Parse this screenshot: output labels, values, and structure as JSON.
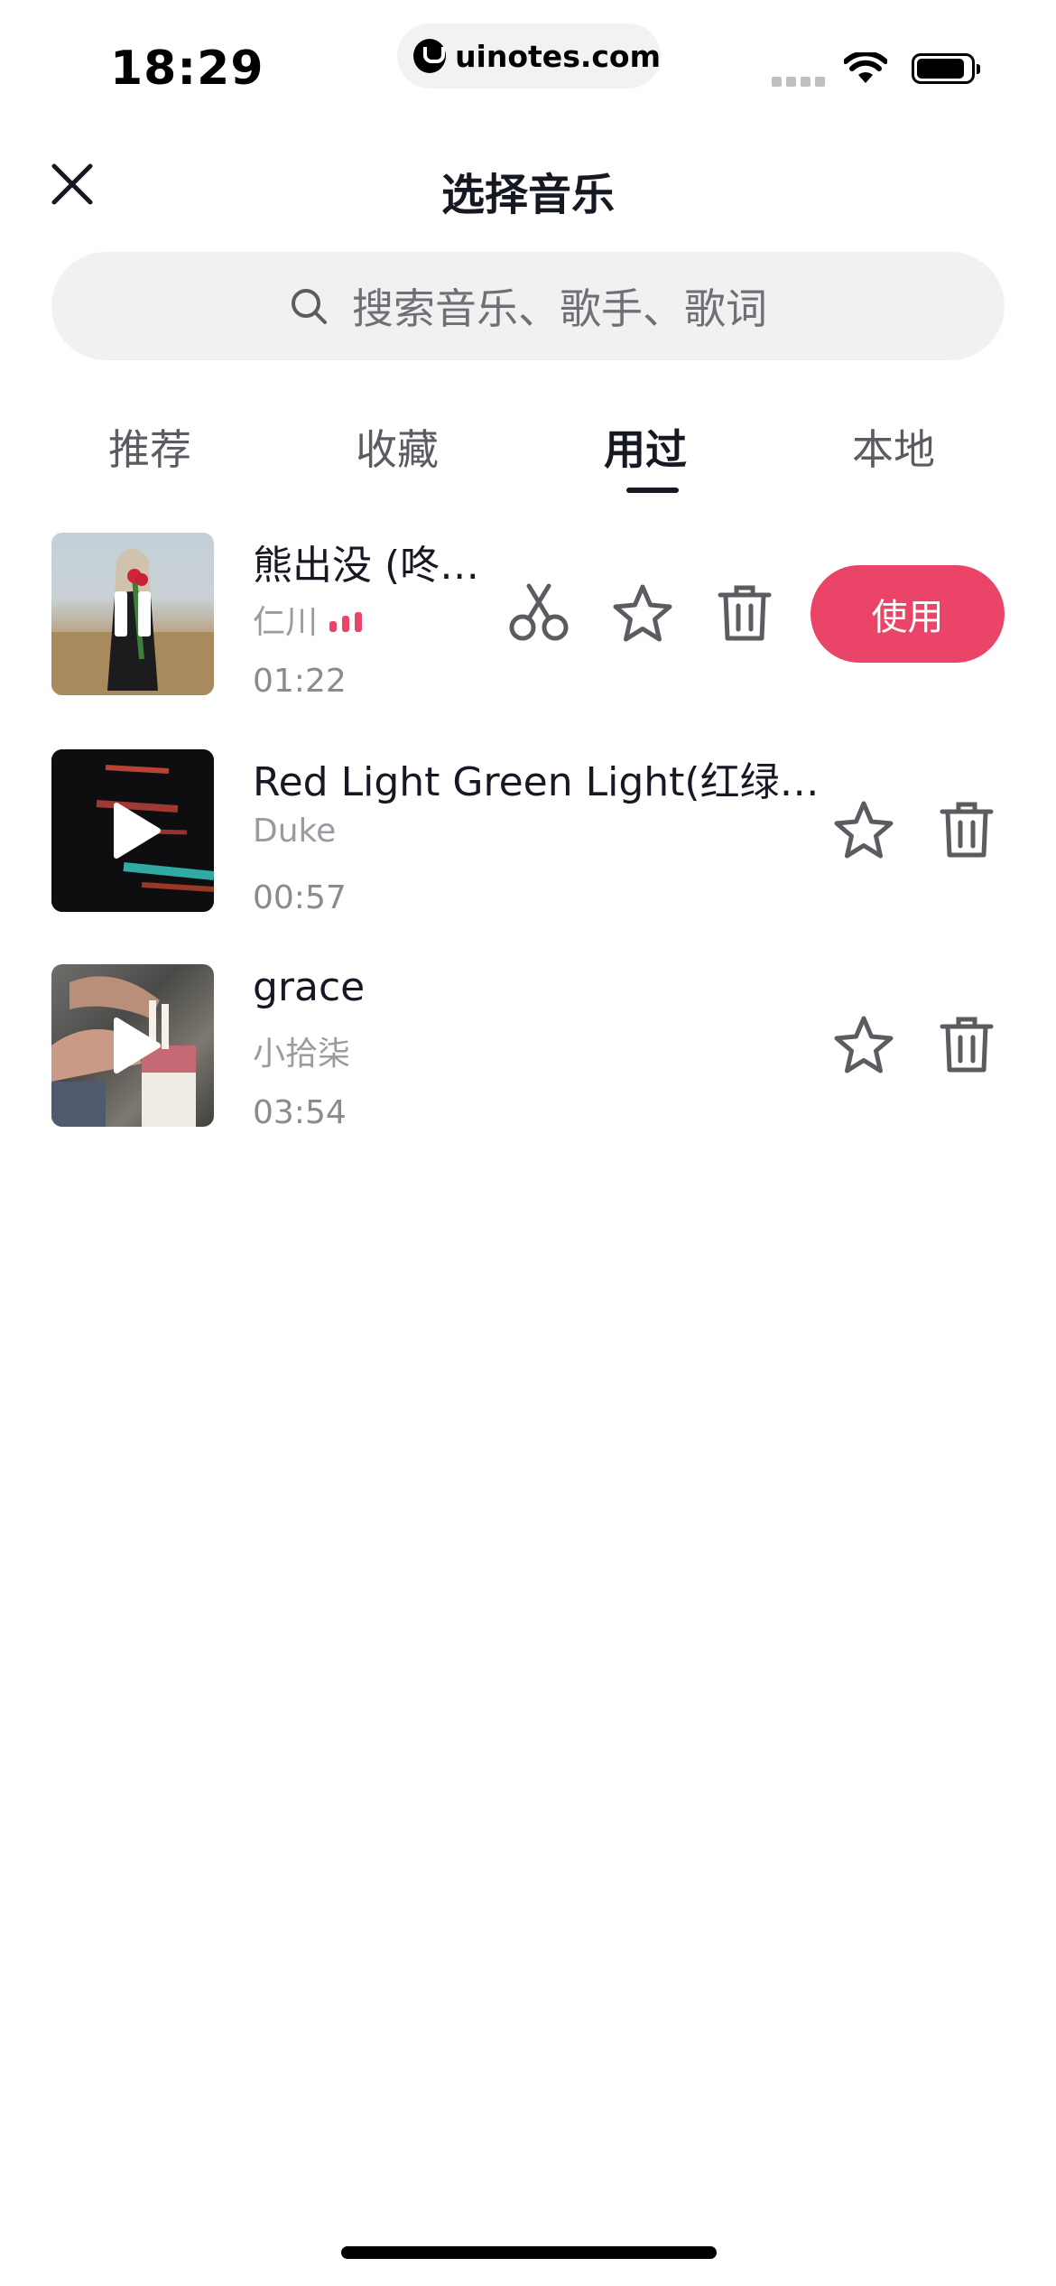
{
  "status_bar": {
    "time": "18:29",
    "url": "uinotes.com",
    "icons": [
      "cellular-signal-icon",
      "wifi-icon",
      "battery-icon"
    ]
  },
  "header": {
    "title": "选择音乐",
    "close_icon": "close-icon"
  },
  "search": {
    "placeholder": "搜索音乐、歌手、歌词",
    "icon": "search-icon"
  },
  "tabs": [
    {
      "label": "推荐",
      "active": false
    },
    {
      "label": "收藏",
      "active": false
    },
    {
      "label": "用过",
      "active": true
    },
    {
      "label": "本地",
      "active": false
    }
  ],
  "songs": [
    {
      "title": "熊出没 (咚…",
      "artist": "仁川",
      "duration": "01:22",
      "state": "playing",
      "actions": [
        "scissors-icon",
        "star-icon",
        "trash-icon"
      ],
      "use_label": "使用"
    },
    {
      "title": "Red Light Green Light(红绿…",
      "artist": "Duke",
      "duration": "00:57",
      "state": "paused",
      "actions": [
        "star-icon",
        "trash-icon"
      ]
    },
    {
      "title": "grace",
      "artist": "小拾柒",
      "duration": "03:54",
      "state": "paused",
      "actions": [
        "star-icon",
        "trash-icon"
      ]
    }
  ],
  "colors": {
    "accent": "#ea4468",
    "text_primary": "#161823",
    "text_secondary": "#9a9aa0",
    "search_bg": "#f1f1f2"
  }
}
